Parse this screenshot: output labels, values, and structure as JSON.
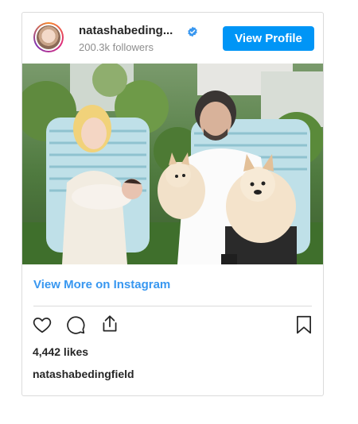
{
  "post": {
    "username": "natashabeding...",
    "followers": "200.3k followers",
    "view_profile_label": "View Profile",
    "view_more_label": "View More on Instagram",
    "likes": "4,442 likes",
    "caption_username": "natashabedingfield"
  },
  "icons": {
    "verified": "verified-badge-icon",
    "like": "heart-icon",
    "comment": "comment-icon",
    "share": "share-icon",
    "save": "bookmark-icon"
  },
  "colors": {
    "accent": "#0095f6",
    "link": "#3897f0",
    "text": "#262626",
    "muted": "#8e8e8e",
    "border": "#dbdbdb"
  }
}
